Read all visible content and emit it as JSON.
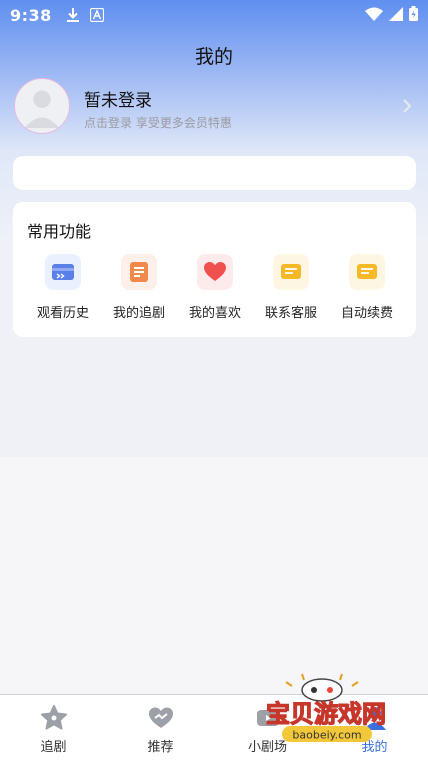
{
  "status_bar": {
    "time": "9:38",
    "icons": [
      "download-icon",
      "a-icon",
      "wifi-icon",
      "signal-icon",
      "battery-icon"
    ]
  },
  "page": {
    "title": "我的"
  },
  "profile": {
    "name": "暂未登录",
    "subtitle": "点击登录 享受更多会员特惠"
  },
  "functions": {
    "title": "常用功能",
    "items": [
      {
        "label": "观看历史",
        "icon": "history-icon"
      },
      {
        "label": "我的追剧",
        "icon": "follow-list-icon"
      },
      {
        "label": "我的喜欢",
        "icon": "heart-icon"
      },
      {
        "label": "联系客服",
        "icon": "message-icon"
      },
      {
        "label": "自动续费",
        "icon": "renew-icon"
      }
    ]
  },
  "bottom_nav": {
    "items": [
      {
        "label": "追剧",
        "icon": "star-icon",
        "active": false
      },
      {
        "label": "推荐",
        "icon": "heart-outline-icon",
        "active": false
      },
      {
        "label": "小剧场",
        "icon": "theater-icon",
        "active": false
      },
      {
        "label": "我的",
        "icon": "user-icon",
        "active": true
      }
    ]
  },
  "watermark": {
    "title": "宝贝游戏网",
    "url": "baobeiy.com"
  },
  "colors": {
    "accent": "#3a6fe0",
    "header_gradient_top": "#5f8ff0",
    "background": "#f6f6f8"
  }
}
